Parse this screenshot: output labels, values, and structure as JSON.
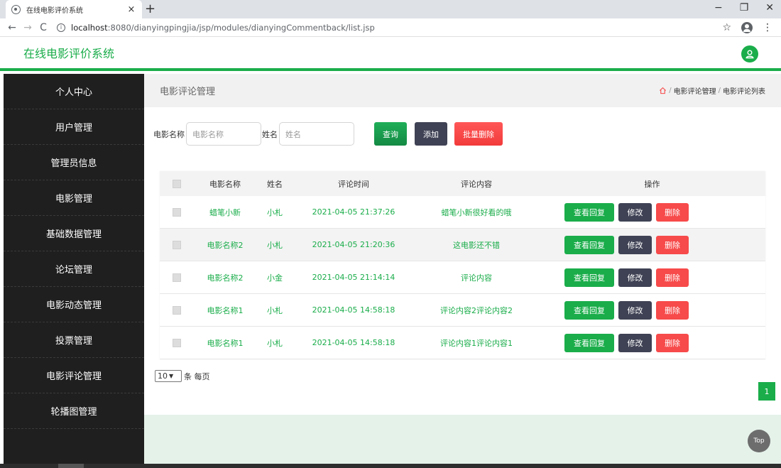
{
  "browser": {
    "tab_title": "在线电影评价系统",
    "tab_close": "×",
    "new_tab": "+",
    "url_host": "localhost",
    "url_rest": ":8080/dianyingpingjia/jsp/modules/dianyingCommentback/list.jsp",
    "win_min": "−",
    "win_max": "❐",
    "win_close": "✕"
  },
  "header": {
    "brand": "在线电影评价系统"
  },
  "sidebar": {
    "items": [
      {
        "label": "个人中心"
      },
      {
        "label": "用户管理"
      },
      {
        "label": "管理员信息"
      },
      {
        "label": "电影管理"
      },
      {
        "label": "基础数据管理"
      },
      {
        "label": "论坛管理"
      },
      {
        "label": "电影动态管理"
      },
      {
        "label": "投票管理"
      },
      {
        "label": "电影评论管理"
      },
      {
        "label": "轮播图管理"
      }
    ]
  },
  "page": {
    "title": "电影评论管理",
    "breadcrumb": [
      "电影评论管理",
      "电影评论列表"
    ]
  },
  "search": {
    "movie_label": "电影名称",
    "movie_placeholder": "电影名称",
    "name_label": "姓名",
    "name_placeholder": "姓名",
    "query": "查询",
    "add": "添加",
    "batch_delete": "批量删除"
  },
  "table": {
    "headers": {
      "movie": "电影名称",
      "user": "姓名",
      "time": "评论时间",
      "content": "评论内容",
      "ops": "操作"
    },
    "rows": [
      {
        "movie": "蜡笔小新",
        "user": "小札",
        "time": "2021-04-05 21:37:26",
        "content": "蜡笔小新很好看的哦"
      },
      {
        "movie": "电影名称2",
        "user": "小札",
        "time": "2021-04-05 21:20:36",
        "content": "这电影还不错"
      },
      {
        "movie": "电影名称2",
        "user": "小金",
        "time": "2021-04-05 21:14:14",
        "content": "评论内容"
      },
      {
        "movie": "电影名称1",
        "user": "小札",
        "time": "2021-04-05 14:58:18",
        "content": "评论内容2评论内容2"
      },
      {
        "movie": "电影名称1",
        "user": "小札",
        "time": "2021-04-05 14:58:18",
        "content": "评论内容1评论内容1"
      }
    ],
    "op_view": "查看回复",
    "op_edit": "修改",
    "op_delete": "删除"
  },
  "pager": {
    "page_size": "10",
    "per_page_label": "条 每页",
    "current_page": "1"
  },
  "top_button": "Top",
  "colors": {
    "accent": "#1aad4a",
    "sidebar": "#1f1f1f",
    "danger": "#f74a4a",
    "dark": "#3f4254"
  }
}
